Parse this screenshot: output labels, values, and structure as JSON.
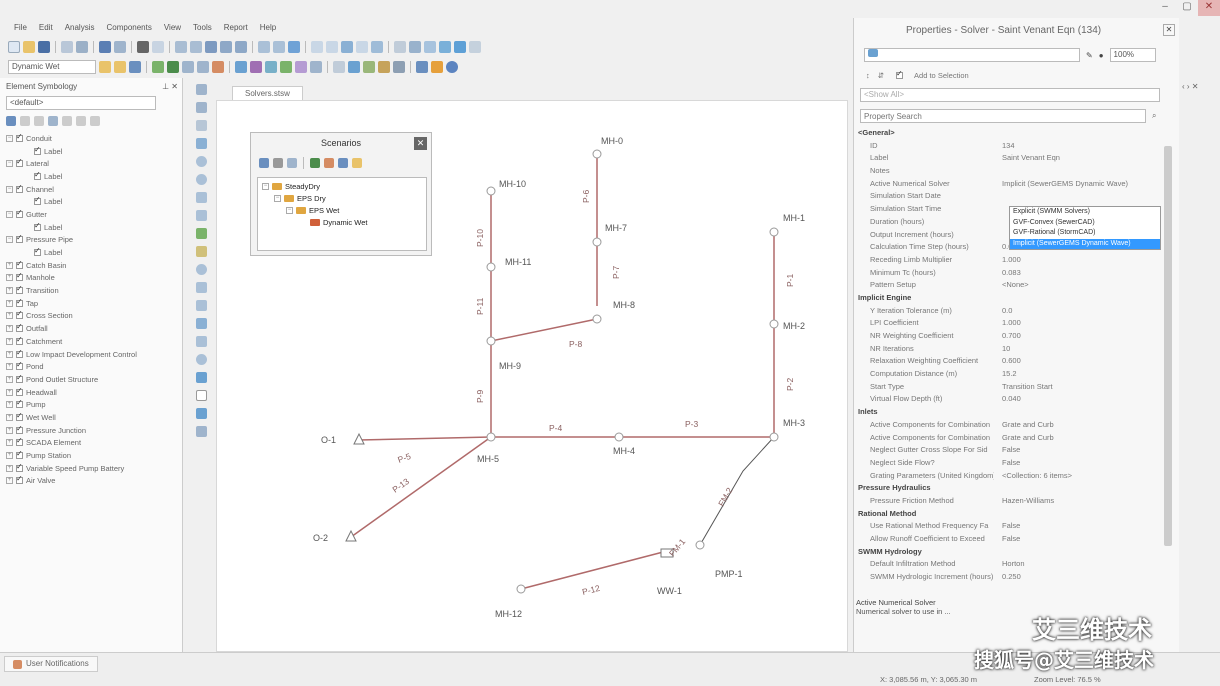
{
  "menu": [
    "File",
    "Edit",
    "Analysis",
    "Components",
    "View",
    "Tools",
    "Report",
    "Help"
  ],
  "toolbar": {
    "scenario_combo": "Dynamic Wet"
  },
  "left_panel": {
    "title": "Element Symbology",
    "combo": "<default>",
    "items": [
      "Conduit",
      "Label",
      "Lateral",
      "Label",
      "Channel",
      "Label",
      "Gutter",
      "Label",
      "Pressure Pipe",
      "Label",
      "Catch Basin",
      "Manhole",
      "Transition",
      "Tap",
      "Cross Section",
      "Outfall",
      "Catchment",
      "Low Impact Development Control",
      "Pond",
      "Pond Outlet Structure",
      "Headwall",
      "Pump",
      "Wet Well",
      "Pressure Junction",
      "SCADA Element",
      "Pump Station",
      "Variable Speed Pump Battery",
      "Air Valve"
    ]
  },
  "doc_tab": "Solvers.stsw",
  "scenarios": {
    "title": "Scenarios",
    "items": [
      "SteadyDry",
      "EPS Dry",
      "EPS Wet",
      "Dynamic Wet"
    ]
  },
  "network": {
    "nodes": [
      "MH-0",
      "MH-10",
      "MH-7",
      "MH-11",
      "MH-9",
      "MH-1",
      "MH-2",
      "MH-3",
      "MH-4",
      "MH-5",
      "O-1",
      "O-2",
      "WW-1",
      "PMP-1",
      "MH-12",
      "MH-8"
    ],
    "pipes": [
      "P-10",
      "P-11",
      "P-9",
      "P-8",
      "P-6",
      "P-7",
      "P-1",
      "P-2",
      "P-3",
      "P-4",
      "P-5",
      "P-13",
      "P-12",
      "FM-1",
      "FM-2"
    ]
  },
  "properties": {
    "title": "Properties - Solver - Saint Venant Eqn (134)",
    "zoom": "100%",
    "add_to_selection": "Add to Selection",
    "show_all": "<Show All>",
    "search_placeholder": "Property Search",
    "rows": [
      {
        "k": "<General>",
        "v": "",
        "sec": true
      },
      {
        "k": "ID",
        "v": "134"
      },
      {
        "k": "Label",
        "v": "Saint Venant Eqn"
      },
      {
        "k": "Notes",
        "v": ""
      },
      {
        "k": "Active Numerical Solver",
        "v": "Implicit (SewerGEMS Dynamic Wave)"
      },
      {
        "k": "Simulation Start Date",
        "v": ""
      },
      {
        "k": "Simulation Start Time",
        "v": ""
      },
      {
        "k": "Duration (hours)",
        "v": ""
      },
      {
        "k": "Output Increment (hours)",
        "v": ""
      },
      {
        "k": "Calculation Time Step (hours)",
        "v": "0.050"
      },
      {
        "k": "Receding Limb Multiplier",
        "v": "1.000"
      },
      {
        "k": "Minimum Tc (hours)",
        "v": "0.083"
      },
      {
        "k": "Pattern Setup",
        "v": "<None>"
      },
      {
        "k": "Implicit Engine",
        "v": "",
        "sec": true
      },
      {
        "k": "Y Iteration Tolerance (m)",
        "v": "0.0"
      },
      {
        "k": "LPI Coefficient",
        "v": "1.000"
      },
      {
        "k": "NR Weighting Coefficient",
        "v": "0.700"
      },
      {
        "k": "NR Iterations",
        "v": "10"
      },
      {
        "k": "Relaxation Weighting Coefficient",
        "v": "0.600"
      },
      {
        "k": "Computation Distance (m)",
        "v": "15.2"
      },
      {
        "k": "Start Type",
        "v": "Transition Start"
      },
      {
        "k": "Virtual Flow Depth (ft)",
        "v": "0.040"
      },
      {
        "k": "Inlets",
        "v": "",
        "sec": true
      },
      {
        "k": "Active Components for Combination",
        "v": "Grate and Curb"
      },
      {
        "k": "Active Components for Combination",
        "v": "Grate and Curb"
      },
      {
        "k": "Neglect Gutter Cross Slope For Sid",
        "v": "False"
      },
      {
        "k": "Neglect Side Flow?",
        "v": "False"
      },
      {
        "k": "Grating Parameters (United Kingdom)",
        "v": "<Collection: 6 items>"
      },
      {
        "k": "Pressure Hydraulics",
        "v": "",
        "sec": true
      },
      {
        "k": "Pressure Friction Method",
        "v": "Hazen-Williams"
      },
      {
        "k": "Rational Method",
        "v": "",
        "sec": true
      },
      {
        "k": "Use Rational Method Frequency Fa",
        "v": "False"
      },
      {
        "k": "Allow Runoff Coefficient to Exceed",
        "v": "False"
      },
      {
        "k": "SWMM Hydrology",
        "v": "",
        "sec": true
      },
      {
        "k": "Default Infiltration Method",
        "v": "Horton"
      },
      {
        "k": "SWMM Hydrologic Increment (hours)",
        "v": "0.250"
      }
    ],
    "dropdown": [
      "Explicit (SWMM Solvers)",
      "GVF-Convex (SewerCAD)",
      "GVF-Rational (StormCAD)",
      "Implicit (SewerGEMS Dynamic Wave)"
    ],
    "desc_title": "Active Numerical Solver",
    "desc_text": "Numerical solver to use in ..."
  },
  "status": {
    "notifications": "User Notifications",
    "coords": "X: 3,085.56 m, Y: 3,065.30 m",
    "zoom": "Zoom Level: 76.5 %"
  },
  "watermark": {
    "top": "艾三维技术",
    "bottom": "搜狐号@艾三维技术"
  }
}
